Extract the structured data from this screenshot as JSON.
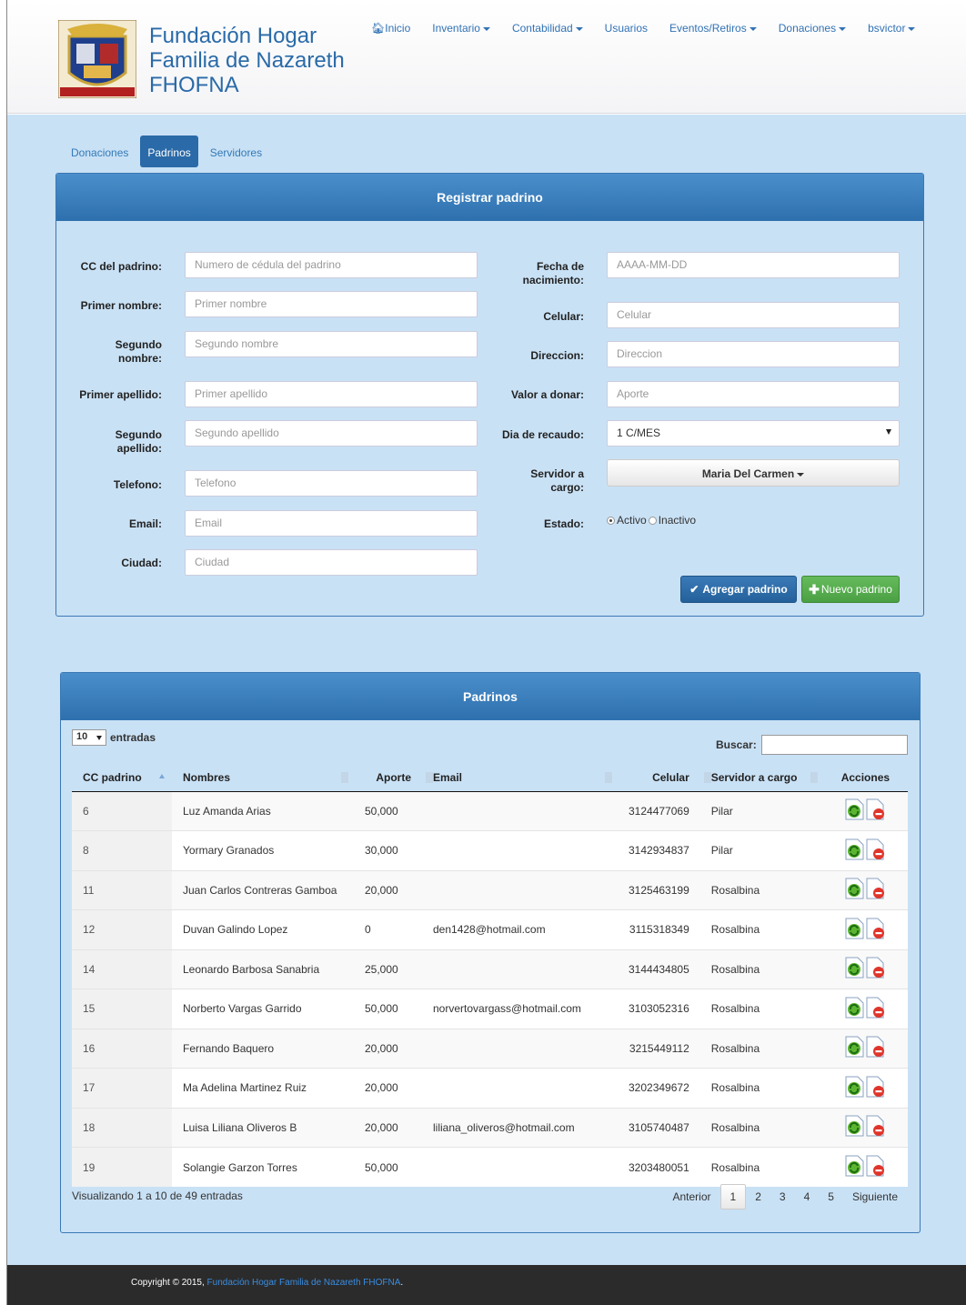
{
  "brand": {
    "line1": "Fundación Hogar",
    "line2": "Familia de Nazareth",
    "line3": "FHOFNA"
  },
  "nav": [
    {
      "label": "Inicio",
      "icon": "home-icon",
      "dropdown": false
    },
    {
      "label": "Inventario",
      "dropdown": true
    },
    {
      "label": "Contabilidad",
      "dropdown": true
    },
    {
      "label": "Usuarios",
      "dropdown": false
    },
    {
      "label": "Eventos/Retiros",
      "dropdown": true
    },
    {
      "label": "Donaciones",
      "dropdown": true
    },
    {
      "label": "bsvictor",
      "dropdown": true
    }
  ],
  "tabs": [
    "Donaciones",
    "Padrinos",
    "Servidores"
  ],
  "form": {
    "title": "Registrar padrino",
    "cc_label": "CC del padrino:",
    "cc_ph": "Numero de cédula del padrino",
    "pn_label": "Primer nombre:",
    "pn_ph": "Primer nombre",
    "sn_label": "Segundo nombre:",
    "sn_ph": "Segundo nombre",
    "pa_label": "Primer apellido:",
    "pa_ph": "Primer apellido",
    "sa_label": "Segundo apellido:",
    "sa_ph": "Segundo apellido",
    "tel_label": "Telefono:",
    "tel_ph": "Telefono",
    "email_label": "Email:",
    "email_ph": "Email",
    "city_label": "Ciudad:",
    "city_ph": "Ciudad",
    "birth_label": "Fecha de nacimiento:",
    "birth_ph": "AAAA-MM-DD",
    "cel_label": "Celular:",
    "cel_ph": "Celular",
    "dir_label": "Direccion:",
    "dir_ph": "Direccion",
    "val_label": "Valor a donar:",
    "val_ph": "Aporte",
    "day_label": "Dia de recaudo:",
    "day_value": "1 C/MES",
    "serv_label": "Servidor a cargo:",
    "serv_value": "Maria Del Carmen",
    "estado_label": "Estado:",
    "estado_activo": "Activo",
    "estado_inactivo": "Inactivo",
    "add_btn": "Agregar padrino",
    "new_btn": "Nuevo padrino"
  },
  "list": {
    "title": "Padrinos",
    "length_value": "10",
    "length_label": "entradas",
    "search_label": "Buscar:",
    "columns": [
      "CC padrino",
      "Nombres",
      "Aporte",
      "Email",
      "Celular",
      "Servidor a cargo",
      "Acciones"
    ],
    "rows": [
      [
        "6",
        "Luz Amanda Arias",
        "50,000",
        "",
        "3124477069",
        "Pilar"
      ],
      [
        "8",
        "Yormary Granados",
        "30,000",
        "",
        "3142934837",
        "Pilar"
      ],
      [
        "11",
        "Juan Carlos Contreras Gamboa",
        "20,000",
        "",
        "3125463199",
        "Rosalbina"
      ],
      [
        "12",
        "Duvan Galindo Lopez",
        "0",
        "den1428@hotmail.com",
        "3115318349",
        "Rosalbina"
      ],
      [
        "14",
        "Leonardo Barbosa Sanabria",
        "25,000",
        "",
        "3144434805",
        "Rosalbina"
      ],
      [
        "15",
        "Norberto Vargas Garrido",
        "50,000",
        "norvertovargass@hotmail.com",
        "3103052316",
        "Rosalbina"
      ],
      [
        "16",
        "Fernando Baquero",
        "20,000",
        "",
        "3215449112",
        "Rosalbina"
      ],
      [
        "17",
        "Ma Adelina Martinez Ruiz",
        "20,000",
        "",
        "3202349672",
        "Rosalbina"
      ],
      [
        "18",
        "Luisa Liliana Oliveros B",
        "20,000",
        "liliana_oliveros@hotmail.com",
        "3105740487",
        "Rosalbina"
      ],
      [
        "19",
        "Solangie Garzon Torres",
        "50,000",
        "",
        "3203480051",
        "Rosalbina"
      ]
    ],
    "info": "Visualizando 1 a 10 de 49 entradas",
    "pager": {
      "prev": "Anterior",
      "pages": [
        "1",
        "2",
        "3",
        "4",
        "5"
      ],
      "next": "Siguiente"
    }
  },
  "footer": {
    "prefix": "Copyright © 2015,",
    "link": "Fundación Hogar Familia de Nazareth FHOFNA",
    "suffix": "."
  }
}
